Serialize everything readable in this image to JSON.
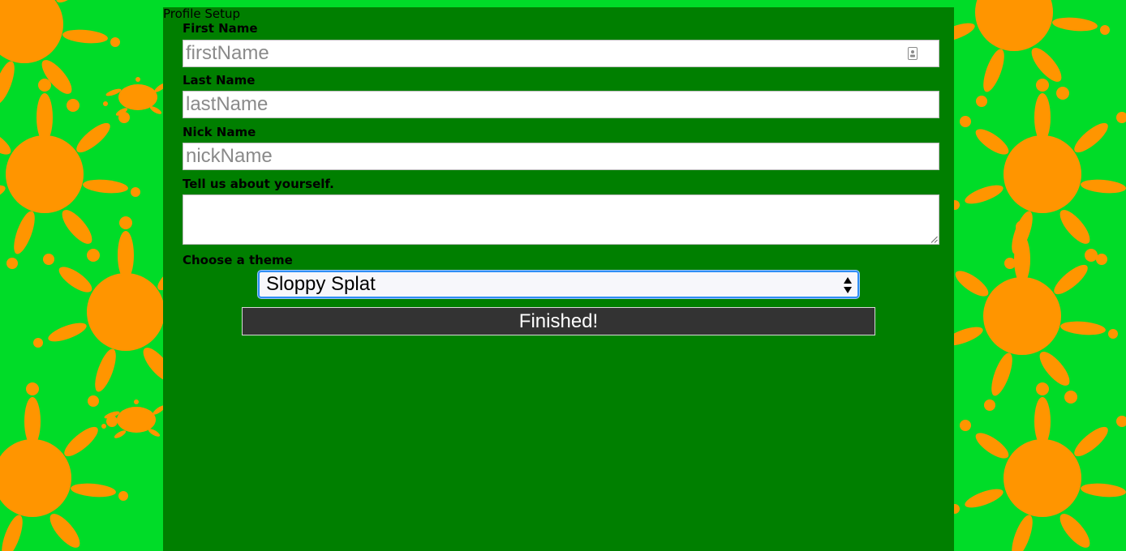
{
  "page": {
    "title": "Profile Setup"
  },
  "form": {
    "first_name": {
      "label": "First Name",
      "value": "",
      "placeholder": "firstName"
    },
    "last_name": {
      "label": "Last Name",
      "value": "",
      "placeholder": "lastName"
    },
    "nick_name": {
      "label": "Nick Name",
      "value": "",
      "placeholder": "nickName"
    },
    "about": {
      "label": "Tell us about yourself.",
      "value": ""
    },
    "theme": {
      "label": "Choose a theme",
      "selected": "Sloppy Splat"
    },
    "submit_label": "Finished!"
  },
  "colors": {
    "background": "#00dc28",
    "splat": "#ff9500",
    "panel": "#007f00",
    "button": "#333333",
    "focus_ring": "#2f8ef5"
  },
  "icons": {
    "autofill": "contact-card-icon",
    "select": "up-down-arrows-icon",
    "resize": "resize-grip-icon"
  }
}
